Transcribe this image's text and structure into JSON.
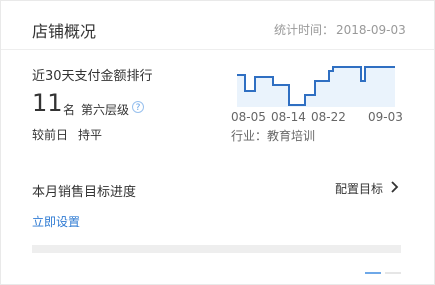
{
  "header": {
    "title": "店铺概况",
    "stat_time_label": "统计时间：",
    "stat_time_value": "2018-09-03"
  },
  "ranking": {
    "label": "近30天支付金额排行",
    "rank": "11",
    "rank_unit": "名",
    "level": "第六层级",
    "compare_label": "较前日",
    "compare_value": "持平"
  },
  "trend_chart": {
    "type": "line",
    "x_ticks": [
      "08-05",
      "08-14",
      "08-22",
      "09-03"
    ],
    "industry": "行业：教育培训",
    "color": "#2f6fc2"
  },
  "goal": {
    "title": "本月销售目标进度",
    "config_label": "配置目标",
    "setup_link": "立即设置",
    "progress": 0
  },
  "colors": {
    "link": "#2f7bd3",
    "accent": "#3a86d6"
  }
}
